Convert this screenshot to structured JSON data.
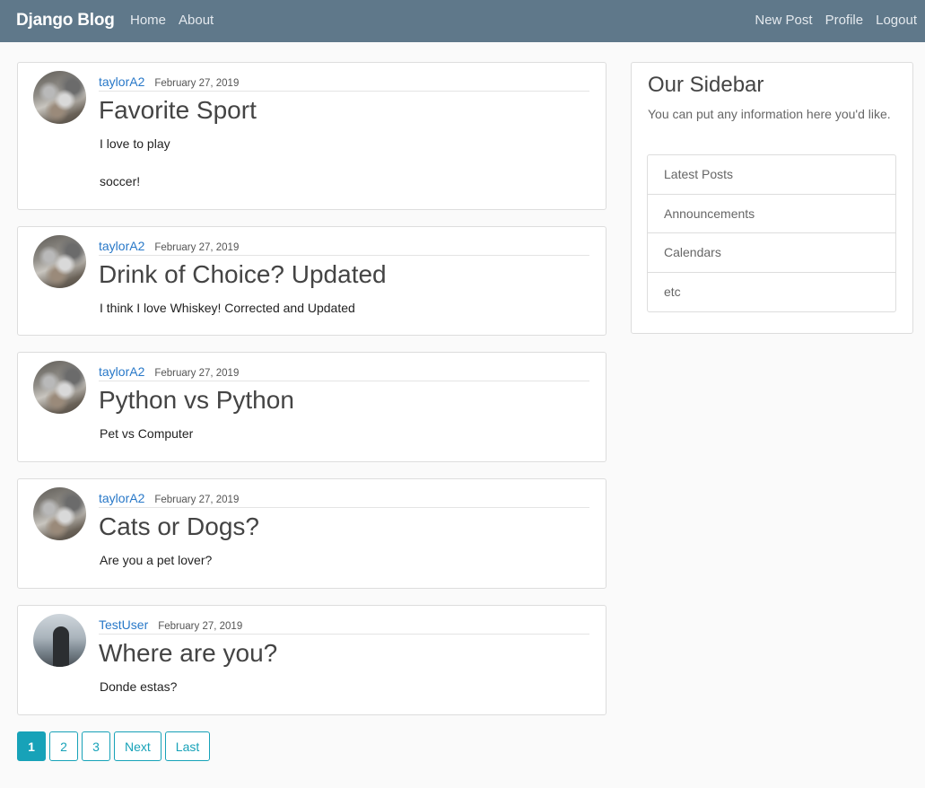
{
  "navbar": {
    "brand": "Django Blog",
    "left_links": [
      "Home",
      "About"
    ],
    "right_links": [
      "New Post",
      "Profile",
      "Logout"
    ],
    "background": "#5f788a"
  },
  "posts": [
    {
      "author": "taylorA2",
      "date": "February 27, 2019",
      "title": "Favorite Sport",
      "content": "I love to play\n\nsoccer!",
      "avatar": "rocks-avatar"
    },
    {
      "author": "taylorA2",
      "date": "February 27, 2019",
      "title": "Drink of Choice? Updated",
      "content": "I think I love Whiskey! Corrected and Updated",
      "avatar": "rocks-avatar"
    },
    {
      "author": "taylorA2",
      "date": "February 27, 2019",
      "title": "Python vs Python",
      "content": "Pet vs Computer",
      "avatar": "rocks-avatar"
    },
    {
      "author": "taylorA2",
      "date": "February 27, 2019",
      "title": "Cats or Dogs?",
      "content": "Are you a pet lover?",
      "avatar": "rocks-avatar"
    },
    {
      "author": "TestUser",
      "date": "February 27, 2019",
      "title": "Where are you?",
      "content": "Donde estas?",
      "avatar": "person-avatar"
    }
  ],
  "sidebar": {
    "title": "Our Sidebar",
    "text": "You can put any information here you'd like.",
    "items": [
      "Latest Posts",
      "Announcements",
      "Calendars",
      "etc"
    ]
  },
  "pagination": {
    "pages": [
      "1",
      "2",
      "3"
    ],
    "current": "1",
    "next": "Next",
    "last": "Last",
    "accent": "#17a2b8"
  }
}
